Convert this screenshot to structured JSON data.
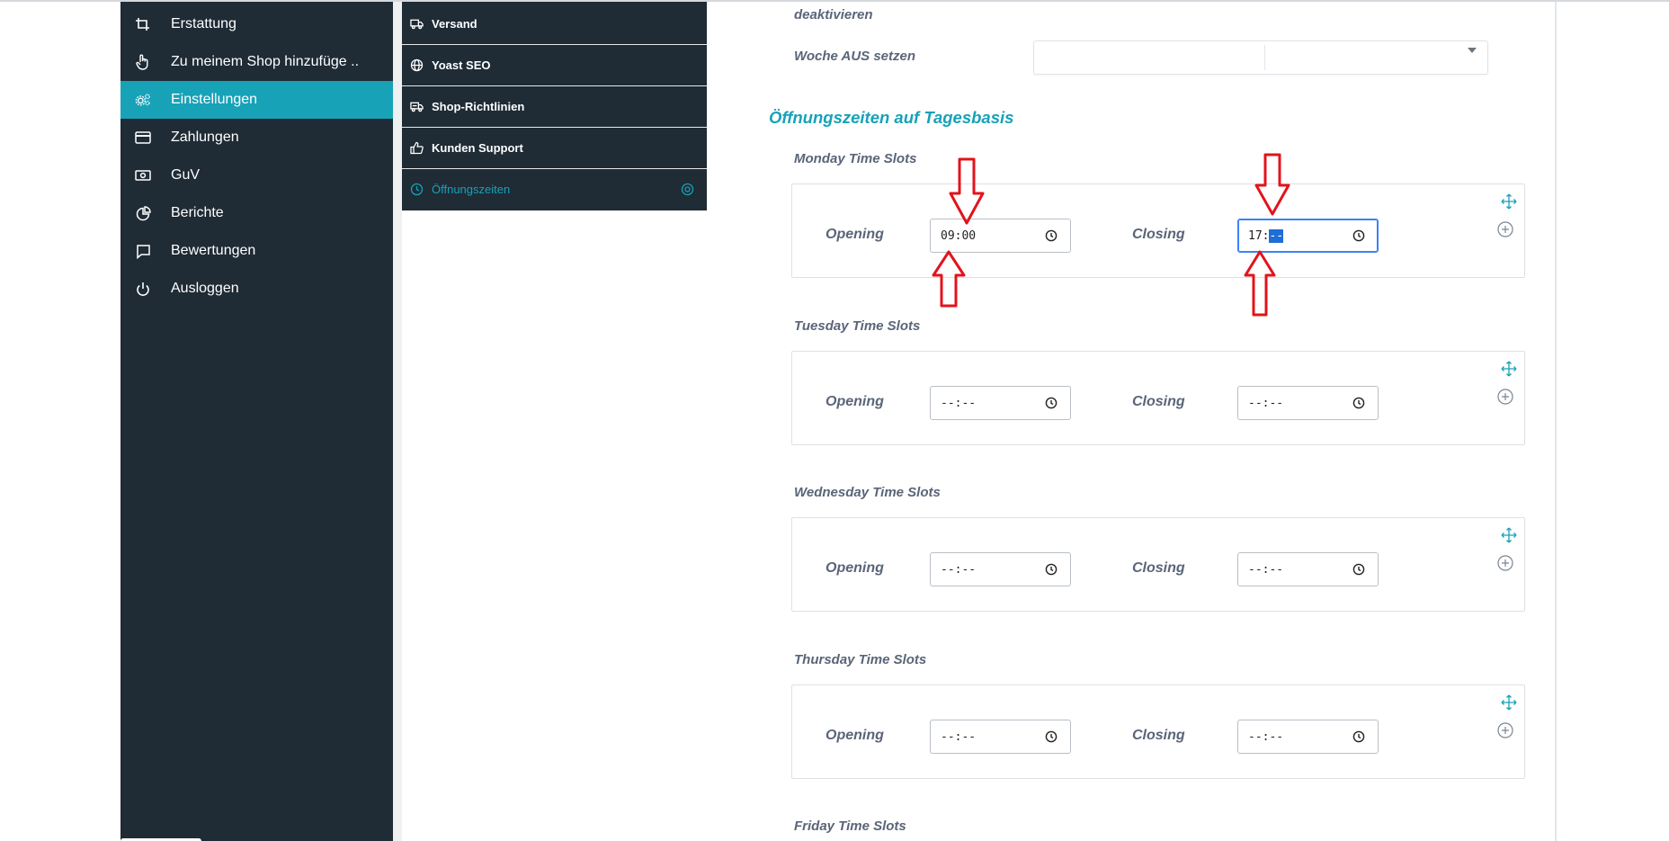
{
  "sidebar": {
    "items": [
      {
        "label": "Erstattung",
        "icon": "crop-icon"
      },
      {
        "label": "Zu meinem Shop hinzufüge ..",
        "icon": "hand-pointer-icon"
      },
      {
        "label": "Einstellungen",
        "icon": "cogs-icon",
        "active": true
      },
      {
        "label": "Zahlungen",
        "icon": "credit-card-icon"
      },
      {
        "label": "GuV",
        "icon": "money-bill-icon"
      },
      {
        "label": "Berichte",
        "icon": "chart-pie-icon"
      },
      {
        "label": "Bewertungen",
        "icon": "comment-icon"
      },
      {
        "label": "Ausloggen",
        "icon": "power-icon"
      }
    ]
  },
  "submenu": {
    "items": [
      {
        "label": "Versand",
        "icon": "truck-icon"
      },
      {
        "label": "Yoast SEO",
        "icon": "globe-icon"
      },
      {
        "label": "Shop-Richtlinien",
        "icon": "shipping-icon"
      },
      {
        "label": "Kunden Support",
        "icon": "thumbs-up-icon"
      },
      {
        "label": "Öffnungszeiten",
        "icon": "clock-icon",
        "active": true
      }
    ]
  },
  "settings": {
    "deactivate_label": "deaktivieren",
    "week_off_label": "Woche AUS setzen",
    "week_off_value": ""
  },
  "hours": {
    "heading": "Öffnungszeiten auf Tagesbasis",
    "opening_label": "Opening",
    "closing_label": "Closing",
    "days": [
      {
        "title": "Monday Time Slots",
        "opening": "09:00",
        "closing_hour": "17:",
        "closing_minutes_selected": "--"
      },
      {
        "title": "Tuesday Time Slots",
        "opening": "--:--",
        "closing": "--:--"
      },
      {
        "title": "Wednesday Time Slots",
        "opening": "--:--",
        "closing": "--:--"
      },
      {
        "title": "Thursday Time Slots",
        "opening": "--:--",
        "closing": "--:--"
      },
      {
        "title": "Friday Time Slots"
      }
    ]
  },
  "colors": {
    "sidebar_bg": "#1f2b35",
    "accent": "#17a2b8",
    "label_text": "#5a6578",
    "annotation_arrow": "#e3131b"
  }
}
